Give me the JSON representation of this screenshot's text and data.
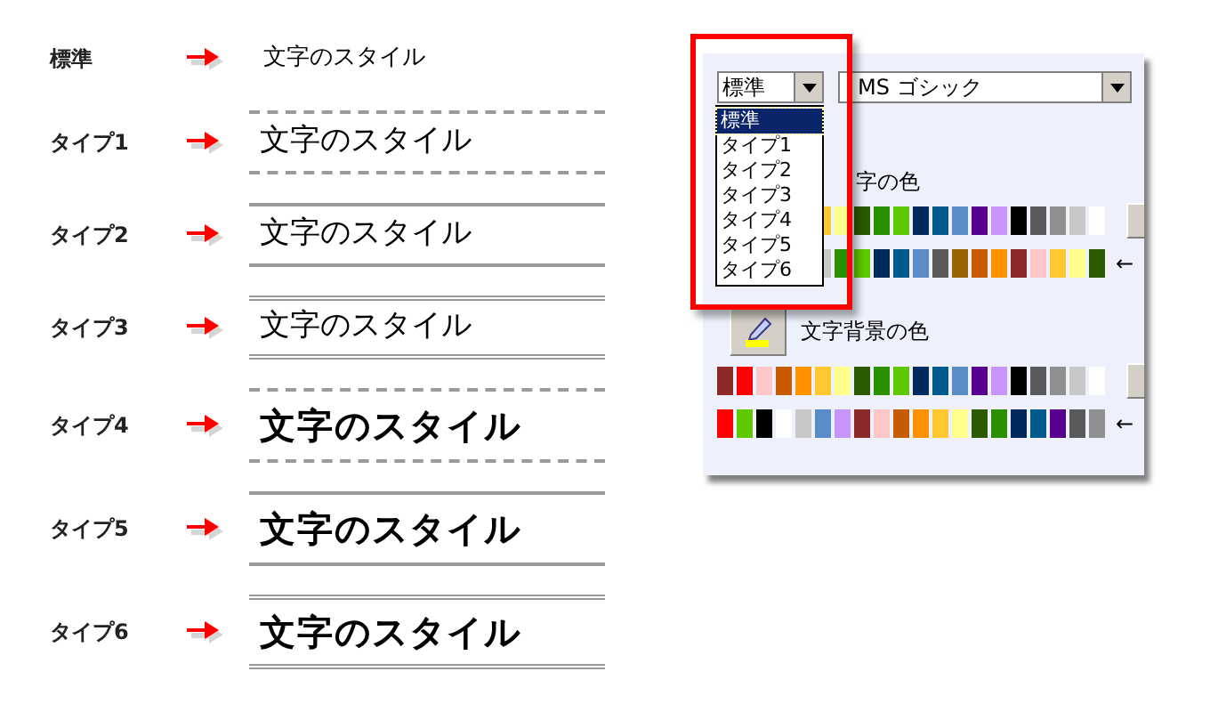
{
  "styles": [
    {
      "label": "標準",
      "sample": "文字のスタイル",
      "kind": "plain",
      "bold": false
    },
    {
      "label": "タイプ1",
      "sample": "文字のスタイル",
      "kind": "dashed",
      "bold": false
    },
    {
      "label": "タイプ2",
      "sample": "文字のスタイル",
      "kind": "solid",
      "bold": false
    },
    {
      "label": "タイプ3",
      "sample": "文字のスタイル",
      "kind": "double",
      "bold": false
    },
    {
      "label": "タイプ4",
      "sample": "文字のスタイル",
      "kind": "dashed",
      "bold": true
    },
    {
      "label": "タイプ5",
      "sample": "文字のスタイル",
      "kind": "solid",
      "bold": true
    },
    {
      "label": "タイプ6",
      "sample": "文字のスタイル",
      "kind": "double",
      "bold": true
    }
  ],
  "panel": {
    "style_select": {
      "value": "標準"
    },
    "font_select": {
      "value": "MS ゴシック"
    },
    "style_list": [
      {
        "label": "標準",
        "selected": true
      },
      {
        "label": "タイプ1",
        "selected": false
      },
      {
        "label": "タイプ2",
        "selected": false
      },
      {
        "label": "タイプ3",
        "selected": false
      },
      {
        "label": "タイプ4",
        "selected": false
      },
      {
        "label": "タイプ5",
        "selected": false
      },
      {
        "label": "タイプ6",
        "selected": false
      }
    ],
    "text_color": {
      "label": "字の色",
      "rows": [
        {
          "swatches": [
            {
              "color": "#ffc830"
            },
            {
              "color": "#ffff8c"
            },
            {
              "color": "#2b5a00"
            },
            {
              "color": "#2a9000"
            },
            {
              "color": "#5ec800"
            },
            {
              "color": "#002a5c"
            },
            {
              "color": "#005a8c"
            },
            {
              "color": "#5a8cc8"
            },
            {
              "color": "#5a0090"
            },
            {
              "color": "#c896fa"
            },
            {
              "color": "#000000"
            },
            {
              "color": "#5a5a5a"
            },
            {
              "color": "#909090"
            },
            {
              "color": "#c8c8c8"
            },
            {
              "color": "#ffffff"
            }
          ],
          "kind": "button"
        },
        {
          "swatches": [
            {
              "color": "#c8c8c8"
            },
            {
              "color": "#2a9000"
            },
            {
              "color": "#5ec800"
            },
            {
              "color": "#002a5c"
            },
            {
              "color": "#005a8c"
            },
            {
              "color": "#5a8cc8"
            },
            {
              "color": "#5a5a5a"
            },
            {
              "color": "#966400"
            },
            {
              "color": "#c85a00"
            },
            {
              "color": "#ff9000"
            },
            {
              "color": "#8c2a2a"
            },
            {
              "color": "#ffc8c8"
            },
            {
              "color": "#ffc830"
            },
            {
              "color": "#ffff8c"
            },
            {
              "color": "#2b5a00"
            }
          ],
          "kind": "arrow",
          "suffix": "←"
        }
      ]
    },
    "background_color": {
      "label": "文字背景の色",
      "rows": [
        {
          "swatches": [
            {
              "color": "#8c2a2a"
            },
            {
              "color": "#ff0000"
            },
            {
              "color": "#ffc8c8"
            },
            {
              "color": "#c85a00"
            },
            {
              "color": "#ff9000"
            },
            {
              "color": "#ffc830"
            },
            {
              "color": "#ffff8c"
            },
            {
              "color": "#2b5a00"
            },
            {
              "color": "#2a9000"
            },
            {
              "color": "#5ec800"
            },
            {
              "color": "#002a5c"
            },
            {
              "color": "#005a8c"
            },
            {
              "color": "#5a8cc8"
            },
            {
              "color": "#5a0090"
            },
            {
              "color": "#c896fa"
            },
            {
              "color": "#000000"
            },
            {
              "color": "#5a5a5a"
            },
            {
              "color": "#909090"
            },
            {
              "color": "#c8c8c8"
            },
            {
              "color": "#ffffff"
            }
          ],
          "kind": "button"
        },
        {
          "swatches": [
            {
              "color": "#ff0000"
            },
            {
              "color": "#5ec800"
            },
            {
              "color": "#000000"
            },
            {
              "color": "#ffffff"
            },
            {
              "color": "#c8c8c8"
            },
            {
              "color": "#5a8cc8"
            },
            {
              "color": "#c896fa"
            },
            {
              "color": "#8c2a2a"
            },
            {
              "color": "#ffc8c8"
            },
            {
              "color": "#c85a00"
            },
            {
              "color": "#ff9000"
            },
            {
              "color": "#ffc830"
            },
            {
              "color": "#ffff8c"
            },
            {
              "color": "#2b5a00"
            },
            {
              "color": "#2a9000"
            },
            {
              "color": "#002a5c"
            },
            {
              "color": "#005a8c"
            },
            {
              "color": "#5a0090"
            },
            {
              "color": "#5a5a5a"
            },
            {
              "color": "#909090"
            }
          ],
          "kind": "arrow",
          "suffix": "←"
        }
      ]
    }
  }
}
